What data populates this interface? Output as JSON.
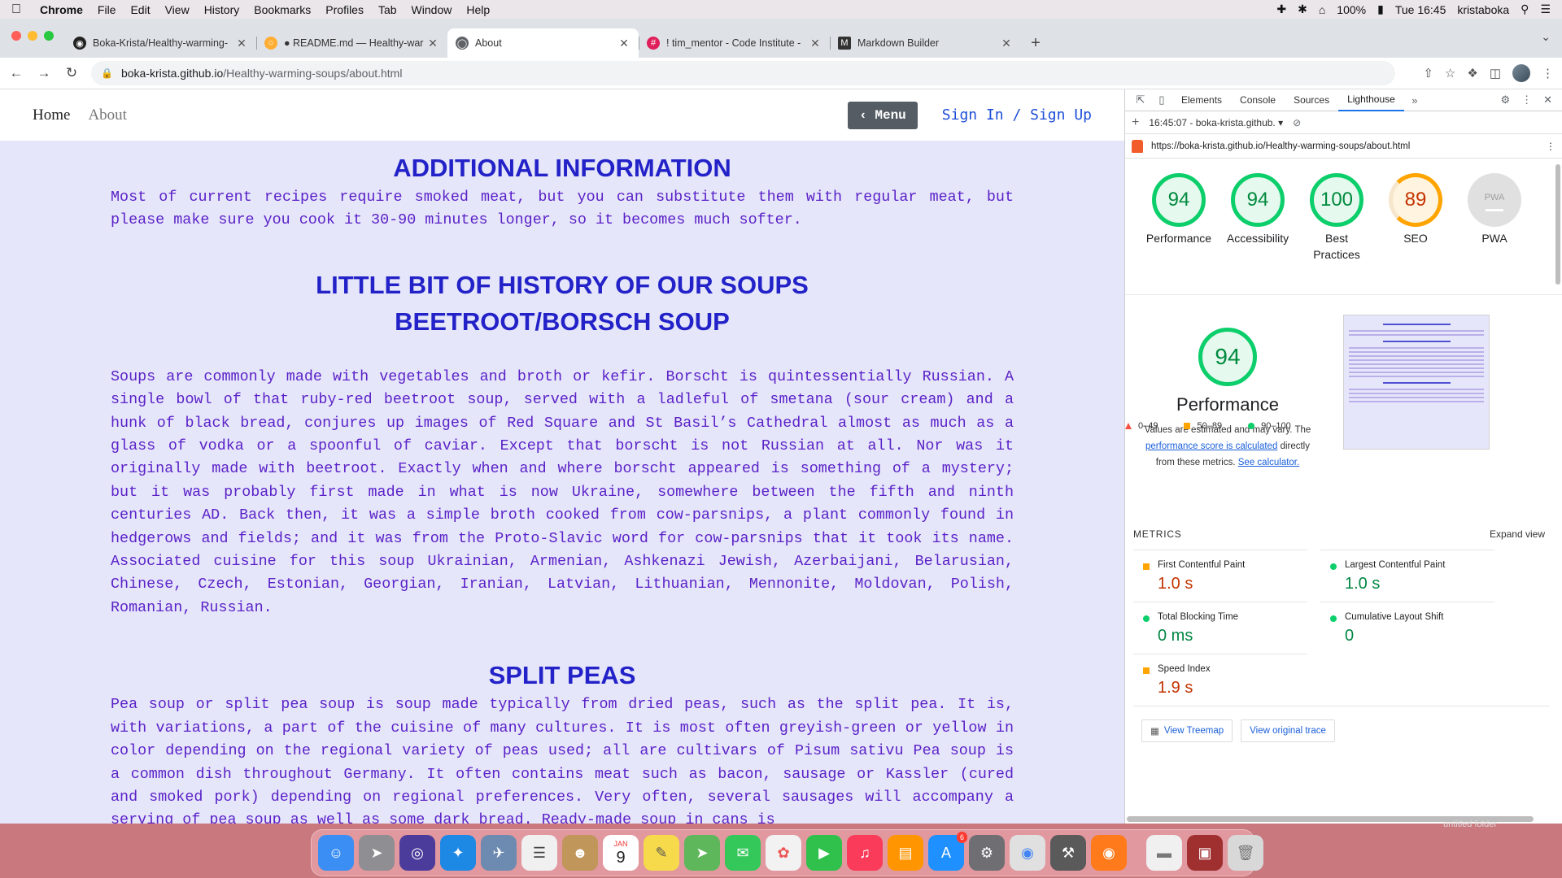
{
  "menubar": {
    "app": "Chrome",
    "items": [
      "File",
      "Edit",
      "View",
      "History",
      "Bookmarks",
      "Profiles",
      "Tab",
      "Window",
      "Help"
    ],
    "battery": "100%",
    "datetime": "Tue 16:45",
    "user": "kristaboka"
  },
  "tabs": [
    {
      "title": "Boka-Krista/Healthy-warming-",
      "icon": "github-icon"
    },
    {
      "title": "● README.md — Healthy-war",
      "icon": "gitpod-icon"
    },
    {
      "title": "About",
      "icon": "globe-icon"
    },
    {
      "title": "! tim_mentor - Code Institute -",
      "icon": "slack-icon"
    },
    {
      "title": "Markdown Builder",
      "icon": "markdown-icon"
    }
  ],
  "address": {
    "host": "boka-krista.github.io",
    "path": "/Healthy-warming-soups/about.html"
  },
  "site": {
    "nav_home": "Home",
    "nav_about": "About",
    "menu_button": "‹ Menu",
    "signin": "Sign In / Sign Up",
    "sections": {
      "additional_title": "ADDITIONAL INFORMATION",
      "additional_text": "Most of current recipes require smoked meat, but you can substitute them with regular meat, but please make sure you cook it 30-90 minutes longer, so it becomes much softer.",
      "history_title": "LITTLE BIT OF HISTORY OF OUR SOUPS",
      "borsch_title": "BEETROOT/BORSCH SOUP",
      "borsch_text": "Soups are commonly made with vegetables and broth or kefir. Borscht is quintessentially Russian. A single bowl of that ruby-red beetroot soup, served with a ladleful of smetana (sour cream) and a hunk of black bread, conjures up images of Red Square and St Basil’s Cathedral almost as much as a glass of vodka or a spoonful of caviar. Except that borscht is not Russian at all. Nor was it originally made with beetroot. Exactly when and where borscht appeared is something of a mystery; but it was probably first made in what is now Ukraine, somewhere between the fifth and ninth centuries AD. Back then, it was a simple broth cooked from cow-parsnips, a plant commonly found in hedgerows and fields; and it was from the Proto-Slavic word for cow-parsnips that it took its name. Associated cuisine for this soup Ukrainian, Armenian, Ashkenazi Jewish, Azerbaijani, Belarusian, Chinese, Czech, Estonian, Georgian, Iranian, Latvian, Lithuanian, Mennonite, Moldovan, Polish, Romanian, Russian.",
      "split_title": "SPLIT PEAS",
      "split_text": "Pea soup or split pea soup is soup made typically from dried peas, such as the split pea. It is, with variations, a part of the cuisine of many cultures. It is most often greyish-green or yellow in color depending on the regional variety of peas used; all are cultivars of Pisum sativu Pea soup is a common dish throughout Germany. It often contains meat such as bacon, sausage or Kassler (cured and smoked pork) depending on regional preferences. Very often, several sausages will accompany a serving of pea soup as well as some dark bread. Ready-made soup in cans is"
    }
  },
  "devtools": {
    "tabs": [
      "Elements",
      "Console",
      "Sources",
      "Lighthouse"
    ],
    "active_tab": "Lighthouse",
    "report_select": "16:45:07 - boka-krista.github.",
    "report_url": "https://boka-krista.github.io/Healthy-warming-soups/about.html",
    "scores": [
      {
        "value": "94",
        "label": "Performance",
        "status": "green"
      },
      {
        "value": "94",
        "label": "Accessibility",
        "status": "green"
      },
      {
        "value": "100",
        "label": "Best Practices",
        "status": "green"
      },
      {
        "value": "89",
        "label": "SEO",
        "status": "orange"
      },
      {
        "value": "PWA",
        "label": "PWA",
        "status": "pwa"
      }
    ],
    "perf": {
      "score": "94",
      "title": "Performance",
      "note_1": "Values are estimated and may vary. The",
      "note_link": "performance score is calculated",
      "note_2": "directly from these metrics.",
      "note_link2": "See calculator."
    },
    "legend": [
      "0–49",
      "50–89",
      "90–100"
    ],
    "metrics_title": "METRICS",
    "expand_view": "Expand view",
    "metrics": [
      {
        "name": "First Contentful Paint",
        "value": "1.0 s",
        "status": "orange"
      },
      {
        "name": "Largest Contentful Paint",
        "value": "1.0 s",
        "status": "green"
      },
      {
        "name": "Total Blocking Time",
        "value": "0 ms",
        "status": "green"
      },
      {
        "name": "Cumulative Layout Shift",
        "value": "0",
        "status": "green"
      },
      {
        "name": "Speed Index",
        "value": "1.9 s",
        "status": "orange"
      }
    ],
    "buttons": {
      "treemap": "View Treemap",
      "trace": "View original trace"
    }
  },
  "desktop": {
    "folder_label": "untitled folder"
  },
  "dock": [
    {
      "icon": "finder-icon",
      "color": "#3b8ef3"
    },
    {
      "icon": "launchpad-icon",
      "color": "#8e8e93"
    },
    {
      "icon": "siri-icon",
      "color": "#4b3c9c"
    },
    {
      "icon": "safari-icon",
      "color": "#1e88e5"
    },
    {
      "icon": "preview-icon",
      "color": "#6d8bb0"
    },
    {
      "icon": "notes-list-icon",
      "color": "#f0f0f0"
    },
    {
      "icon": "contacts-icon",
      "color": "#c0965a"
    },
    {
      "icon": "calendar-icon",
      "color": "#ffffff"
    },
    {
      "icon": "notes-icon",
      "color": "#f7d94c"
    },
    {
      "icon": "maps-icon",
      "color": "#5fb75c"
    },
    {
      "icon": "messages-icon",
      "color": "#34c759"
    },
    {
      "icon": "photos-icon",
      "color": "#f2f2f2"
    },
    {
      "icon": "facetime-icon",
      "color": "#30c04c"
    },
    {
      "icon": "music-icon",
      "color": "#fa3c5a"
    },
    {
      "icon": "books-icon",
      "color": "#ff9500"
    },
    {
      "icon": "appstore-icon",
      "color": "#1e90ff"
    },
    {
      "icon": "settings-icon",
      "color": "#6e6e73"
    },
    {
      "icon": "chrome-icon",
      "color": "#e0e0e0"
    },
    {
      "icon": "instruments-icon",
      "color": "#5a5a5a"
    },
    {
      "icon": "firefox-icon",
      "color": "#ff7a1a"
    },
    {
      "icon": "downloads-icon",
      "color": "#f0f0f0"
    },
    {
      "icon": "screenshot-icon",
      "color": "#a03030"
    },
    {
      "icon": "trash-icon",
      "color": "#d8d8d8"
    }
  ],
  "calendar_month": "JAN",
  "calendar_day": "9",
  "appstore_badge": "6"
}
